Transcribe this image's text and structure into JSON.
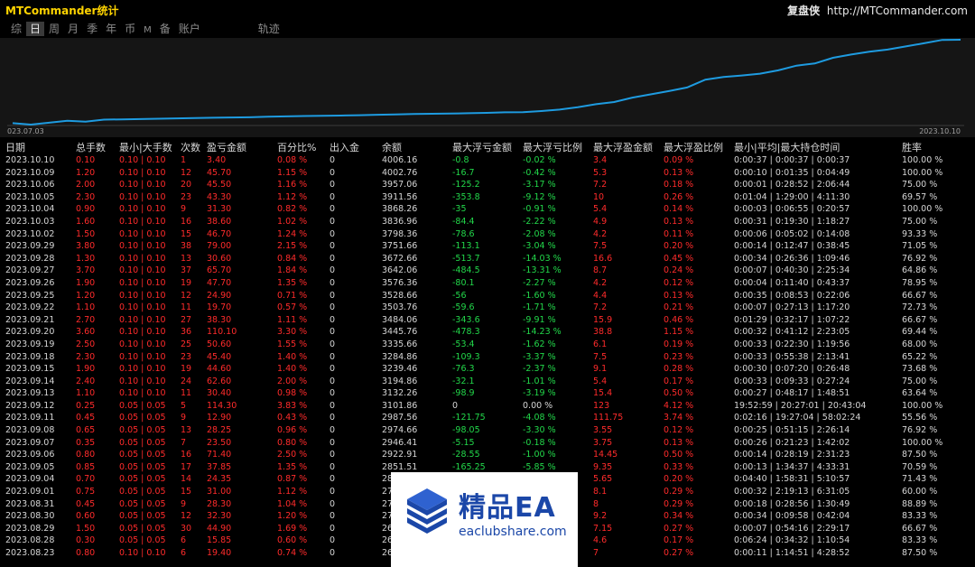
{
  "window": {
    "title": "MTCommander统计",
    "brand_name": "复盘侠",
    "brand_url": "http://MTCommander.com"
  },
  "tabs": [
    {
      "label": "综"
    },
    {
      "label": "日",
      "active": true
    },
    {
      "label": "周"
    },
    {
      "label": "月"
    },
    {
      "label": "季"
    },
    {
      "label": "年"
    },
    {
      "label": "币"
    },
    {
      "label": "M"
    },
    {
      "label": "备"
    },
    {
      "label": "账户"
    },
    {
      "label": "轨迹"
    }
  ],
  "chart": {
    "start_label": "023.07.03",
    "end_label": "2023.10.10",
    "line_color": "#1e9be0",
    "points": [
      2835,
      2815,
      2842,
      2870,
      2855,
      2885,
      2888,
      2892,
      2897,
      2902,
      2906,
      2911,
      2915,
      2918,
      2925,
      2930,
      2935,
      2938,
      2942,
      2947,
      2953,
      2958,
      2963,
      2967,
      2970,
      2975,
      2980,
      2987,
      2990,
      3005,
      3025,
      3060,
      3101,
      3132,
      3194,
      3239,
      3285,
      3336,
      3446,
      3484,
      3504,
      3529,
      3576,
      3642,
      3673,
      3752,
      3798,
      3837,
      3868,
      3912,
      3957,
      4003,
      4006
    ]
  },
  "table": {
    "headers": [
      "日期",
      "总手数",
      "最小|大手数",
      "次数",
      "盈亏金额",
      "百分比%",
      "出入金",
      "余额",
      "最大浮亏金额",
      "最大浮亏比例",
      "最大浮盈金额",
      "最大浮盈比例",
      "最小|平均|最大持仓时间",
      "胜率"
    ],
    "rows": [
      [
        "2023.10.10",
        "0.10",
        "0.10 | 0.10",
        "1",
        "3.40",
        "0.08 %",
        "0",
        "4006.16",
        "-0.8",
        "-0.02 %",
        "3.4",
        "0.09 %",
        "0:00:37 | 0:00:37 | 0:00:37",
        "100.00 %"
      ],
      [
        "2023.10.09",
        "1.20",
        "0.10 | 0.10",
        "12",
        "45.70",
        "1.15 %",
        "0",
        "4002.76",
        "-16.7",
        "-0.42 %",
        "5.3",
        "0.13 %",
        "0:00:10 | 0:01:35 | 0:04:49",
        "100.00 %"
      ],
      [
        "2023.10.06",
        "2.00",
        "0.10 | 0.10",
        "20",
        "45.50",
        "1.16 %",
        "0",
        "3957.06",
        "-125.2",
        "-3.17 %",
        "7.2",
        "0.18 %",
        "0:00:01 | 0:28:52 | 2:06:44",
        "75.00 %"
      ],
      [
        "2023.10.05",
        "2.30",
        "0.10 | 0.10",
        "23",
        "43.30",
        "1.12 %",
        "0",
        "3911.56",
        "-353.8",
        "-9.12 %",
        "10",
        "0.26 %",
        "0:01:04 | 1:29:00 | 4:11:30",
        "69.57 %"
      ],
      [
        "2023.10.04",
        "0.90",
        "0.10 | 0.10",
        "9",
        "31.30",
        "0.82 %",
        "0",
        "3868.26",
        "-35",
        "-0.91 %",
        "5.4",
        "0.14 %",
        "0:00:03 | 0:06:55 | 0:20:57",
        "100.00 %"
      ],
      [
        "2023.10.03",
        "1.60",
        "0.10 | 0.10",
        "16",
        "38.60",
        "1.02 %",
        "0",
        "3836.96",
        "-84.4",
        "-2.22 %",
        "4.9",
        "0.13 %",
        "0:00:31 | 0:19:30 | 1:18:27",
        "75.00 %"
      ],
      [
        "2023.10.02",
        "1.50",
        "0.10 | 0.10",
        "15",
        "46.70",
        "1.24 %",
        "0",
        "3798.36",
        "-78.6",
        "-2.08 %",
        "4.2",
        "0.11 %",
        "0:00:06 | 0:05:02 | 0:14:08",
        "93.33 %"
      ],
      [
        "2023.09.29",
        "3.80",
        "0.10 | 0.10",
        "38",
        "79.00",
        "2.15 %",
        "0",
        "3751.66",
        "-113.1",
        "-3.04 %",
        "7.5",
        "0.20 %",
        "0:00:14 | 0:12:47 | 0:38:45",
        "71.05 %"
      ],
      [
        "2023.09.28",
        "1.30",
        "0.10 | 0.10",
        "13",
        "30.60",
        "0.84 %",
        "0",
        "3672.66",
        "-513.7",
        "-14.03 %",
        "16.6",
        "0.45 %",
        "0:00:34 | 0:26:36 | 1:09:46",
        "76.92 %"
      ],
      [
        "2023.09.27",
        "3.70",
        "0.10 | 0.10",
        "37",
        "65.70",
        "1.84 %",
        "0",
        "3642.06",
        "-484.5",
        "-13.31 %",
        "8.7",
        "0.24 %",
        "0:00:07 | 0:40:30 | 2:25:34",
        "64.86 %"
      ],
      [
        "2023.09.26",
        "1.90",
        "0.10 | 0.10",
        "19",
        "47.70",
        "1.35 %",
        "0",
        "3576.36",
        "-80.1",
        "-2.27 %",
        "4.2",
        "0.12 %",
        "0:00:04 | 0:11:40 | 0:43:37",
        "78.95 %"
      ],
      [
        "2023.09.25",
        "1.20",
        "0.10 | 0.10",
        "12",
        "24.90",
        "0.71 %",
        "0",
        "3528.66",
        "-56",
        "-1.60 %",
        "4.4",
        "0.13 %",
        "0:00:35 | 0:08:53 | 0:22:06",
        "66.67 %"
      ],
      [
        "2023.09.22",
        "1.10",
        "0.10 | 0.10",
        "11",
        "19.70",
        "0.57 %",
        "0",
        "3503.76",
        "-59.6",
        "-1.71 %",
        "7.2",
        "0.21 %",
        "0:00:07 | 0:27:13 | 1:17:20",
        "72.73 %"
      ],
      [
        "2023.09.21",
        "2.70",
        "0.10 | 0.10",
        "27",
        "38.30",
        "1.11 %",
        "0",
        "3484.06",
        "-343.6",
        "-9.91 %",
        "15.9",
        "0.46 %",
        "0:01:29 | 0:32:17 | 1:07:22",
        "66.67 %"
      ],
      [
        "2023.09.20",
        "3.60",
        "0.10 | 0.10",
        "36",
        "110.10",
        "3.30 %",
        "0",
        "3445.76",
        "-478.3",
        "-14.23 %",
        "38.8",
        "1.15 %",
        "0:00:32 | 0:41:12 | 2:23:05",
        "69.44 %"
      ],
      [
        "2023.09.19",
        "2.50",
        "0.10 | 0.10",
        "25",
        "50.60",
        "1.55 %",
        "0",
        "3335.66",
        "-53.4",
        "-1.62 %",
        "6.1",
        "0.19 %",
        "0:00:33 | 0:22:30 | 1:19:56",
        "68.00 %"
      ],
      [
        "2023.09.18",
        "2.30",
        "0.10 | 0.10",
        "23",
        "45.40",
        "1.40 %",
        "0",
        "3284.86",
        "-109.3",
        "-3.37 %",
        "7.5",
        "0.23 %",
        "0:00:33 | 0:55:38 | 2:13:41",
        "65.22 %"
      ],
      [
        "2023.09.15",
        "1.90",
        "0.10 | 0.10",
        "19",
        "44.60",
        "1.40 %",
        "0",
        "3239.46",
        "-76.3",
        "-2.37 %",
        "9.1",
        "0.28 %",
        "0:00:30 | 0:07:20 | 0:26:48",
        "73.68 %"
      ],
      [
        "2023.09.14",
        "2.40",
        "0.10 | 0.10",
        "24",
        "62.60",
        "2.00 %",
        "0",
        "3194.86",
        "-32.1",
        "-1.01 %",
        "5.4",
        "0.17 %",
        "0:00:33 | 0:09:33 | 0:27:24",
        "75.00 %"
      ],
      [
        "2023.09.13",
        "1.10",
        "0.10 | 0.10",
        "11",
        "30.40",
        "0.98 %",
        "0",
        "3132.26",
        "-98.9",
        "-3.19 %",
        "15.4",
        "0.50 %",
        "0:00:27 | 0:48:17 | 1:48:51",
        "63.64 %"
      ],
      [
        "2023.09.12",
        "0.25",
        "0.05 | 0.05",
        "5",
        "114.30",
        "3.83 %",
        "0",
        "3101.86",
        "0",
        "0.00 %",
        "123",
        "4.12 %",
        "19:52:59 | 20:27:01 | 20:43:04",
        "100.00 %"
      ],
      [
        "2023.09.11",
        "0.45",
        "0.05 | 0.05",
        "9",
        "12.90",
        "0.43 %",
        "0",
        "2987.56",
        "-121.75",
        "-4.08 %",
        "111.75",
        "3.74 %",
        "0:02:16 | 19:27:04 | 58:02:24",
        "55.56 %"
      ],
      [
        "2023.09.08",
        "0.65",
        "0.05 | 0.05",
        "13",
        "28.25",
        "0.96 %",
        "0",
        "2974.66",
        "-98.05",
        "-3.30 %",
        "3.55",
        "0.12 %",
        "0:00:25 | 0:51:15 | 2:26:14",
        "76.92 %"
      ],
      [
        "2023.09.07",
        "0.35",
        "0.05 | 0.05",
        "7",
        "23.50",
        "0.80 %",
        "0",
        "2946.41",
        "-5.15",
        "-0.18 %",
        "3.75",
        "0.13 %",
        "0:00:26 | 0:21:23 | 1:42:02",
        "100.00 %"
      ],
      [
        "2023.09.06",
        "0.80",
        "0.05 | 0.05",
        "16",
        "71.40",
        "2.50 %",
        "0",
        "2922.91",
        "-28.55",
        "-1.00 %",
        "14.45",
        "0.50 %",
        "0:00:14 | 0:28:19 | 2:31:23",
        "87.50 %"
      ],
      [
        "2023.09.05",
        "0.85",
        "0.05 | 0.05",
        "17",
        "37.85",
        "1.35 %",
        "0",
        "2851.51",
        "-165.25",
        "-5.85 %",
        "9.35",
        "0.33 %",
        "0:00:13 | 1:34:37 | 4:33:31",
        "70.59 %"
      ],
      [
        "2023.09.04",
        "0.70",
        "0.05 | 0.05",
        "14",
        "24.35",
        "0.87 %",
        "0",
        "28",
        "",
        "",
        "5.65",
        "0.20 %",
        "0:04:40 | 1:58:31 | 5:10:57",
        "71.43 %"
      ],
      [
        "2023.09.01",
        "0.75",
        "0.05 | 0.05",
        "15",
        "31.00",
        "1.12 %",
        "0",
        "27",
        "",
        "",
        "8.1",
        "0.29 %",
        "0:00:32 | 2:19:13 | 6:31:05",
        "60.00 %"
      ],
      [
        "2023.08.31",
        "0.45",
        "0.05 | 0.05",
        "9",
        "28.30",
        "1.04 %",
        "0",
        "27",
        "",
        "",
        "8",
        "0.29 %",
        "0:00:18 | 0:28:56 | 1:30:49",
        "88.89 %"
      ],
      [
        "2023.08.30",
        "0.60",
        "0.05 | 0.05",
        "12",
        "32.30",
        "1.20 %",
        "0",
        "27",
        "",
        "",
        "9.2",
        "0.34 %",
        "0:00:34 | 0:09:58 | 0:42:04",
        "83.33 %"
      ],
      [
        "2023.08.29",
        "1.50",
        "0.05 | 0.05",
        "30",
        "44.90",
        "1.69 %",
        "0",
        "26",
        "",
        "",
        "7.15",
        "0.27 %",
        "0:00:07 | 0:54:16 | 2:29:17",
        "66.67 %"
      ],
      [
        "2023.08.28",
        "0.30",
        "0.05 | 0.05",
        "6",
        "15.85",
        "0.60 %",
        "0",
        "26",
        "",
        "",
        "4.6",
        "0.17 %",
        "0:06:24 | 0:34:32 | 1:10:54",
        "83.33 %"
      ],
      [
        "2023.08.23",
        "0.80",
        "0.10 | 0.10",
        "6",
        "19.40",
        "0.74 %",
        "0",
        "26",
        "",
        "",
        "7",
        "0.27 %",
        "0:00:11 | 1:14:51 | 4:28:52",
        "87.50 %"
      ]
    ]
  },
  "watermark": {
    "title": "精品EA",
    "url": "eaclubshare.com"
  }
}
